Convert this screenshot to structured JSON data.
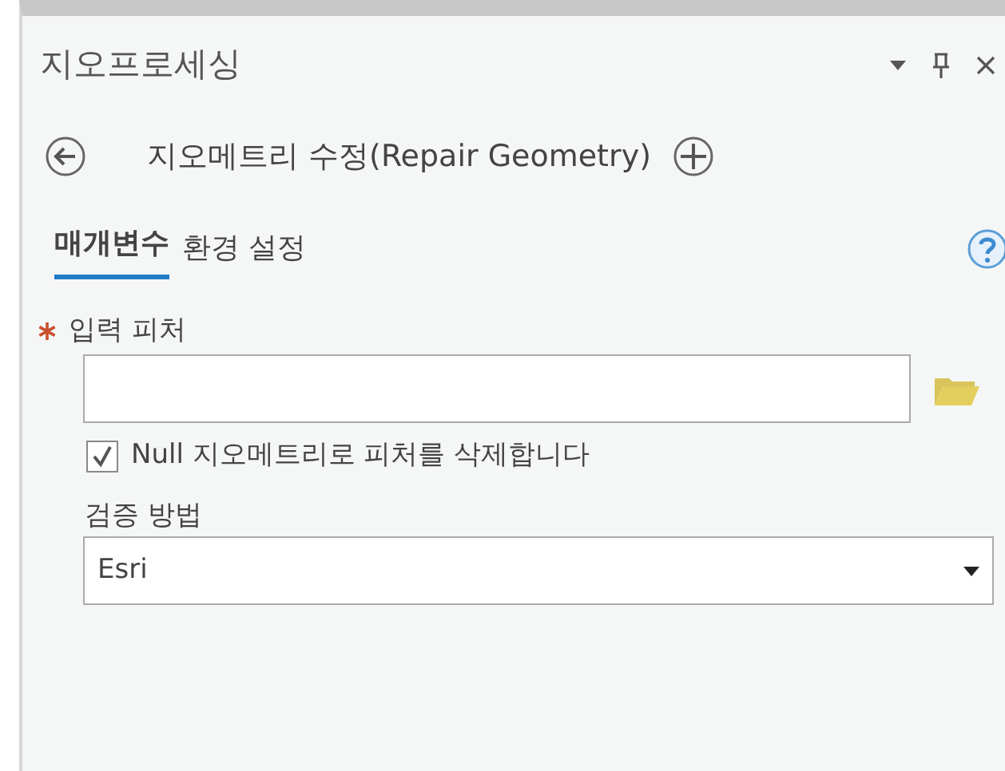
{
  "pane": {
    "title": "지오프로세싱"
  },
  "tool": {
    "title": "지오메트리 수정(Repair Geometry)"
  },
  "tabs": [
    {
      "label": "매개변수",
      "selected": true
    },
    {
      "label": "환경 설정",
      "selected": false
    }
  ],
  "parameters": [
    {
      "kind": "input",
      "label": "입력 피처",
      "required": true
    },
    {
      "kind": "checkbox",
      "label": "Null 지오메트리로 피처를 삭제합니다",
      "checked": true
    },
    {
      "kind": "dropdown",
      "label": "검증 방법",
      "value": "Esri"
    }
  ]
}
